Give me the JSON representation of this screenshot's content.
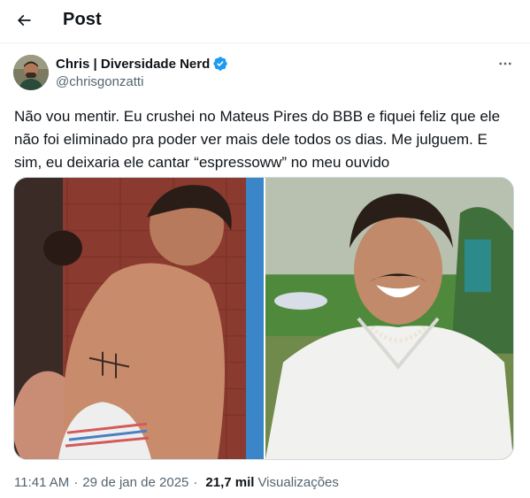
{
  "header": {
    "title": "Post",
    "back_icon": "arrow-left-icon"
  },
  "author": {
    "name": "Chris | Diversidade Nerd",
    "handle": "@chrisgonzatti",
    "verified_icon": "verified-badge-icon",
    "verified_color": "#1d9bf0"
  },
  "more_icon": "more-horizontal-icon",
  "tweet": {
    "text": "Não vou mentir. Eu crushei no Mateus Pires do BBB e fiquei feliz que ele não foi eliminado pra poder ver mais dele todos os dias. Me julguem. E sim, eu deixaria ele cantar “espressoww” no meu ouvido"
  },
  "media": {
    "photos": [
      {
        "description_icon": "photo-shirtless-man-shower"
      },
      {
        "description_icon": "photo-laughing-man-white-shirt"
      }
    ]
  },
  "meta": {
    "time": "11:41 AM",
    "date": "29 de jan de 2025",
    "separator": "·",
    "views_count": "21,7 mil",
    "views_label": "Visualizações"
  },
  "colors": {
    "text": "#0f1419",
    "secondary": "#536471",
    "border": "#cfd9de",
    "accent": "#1d9bf0"
  }
}
